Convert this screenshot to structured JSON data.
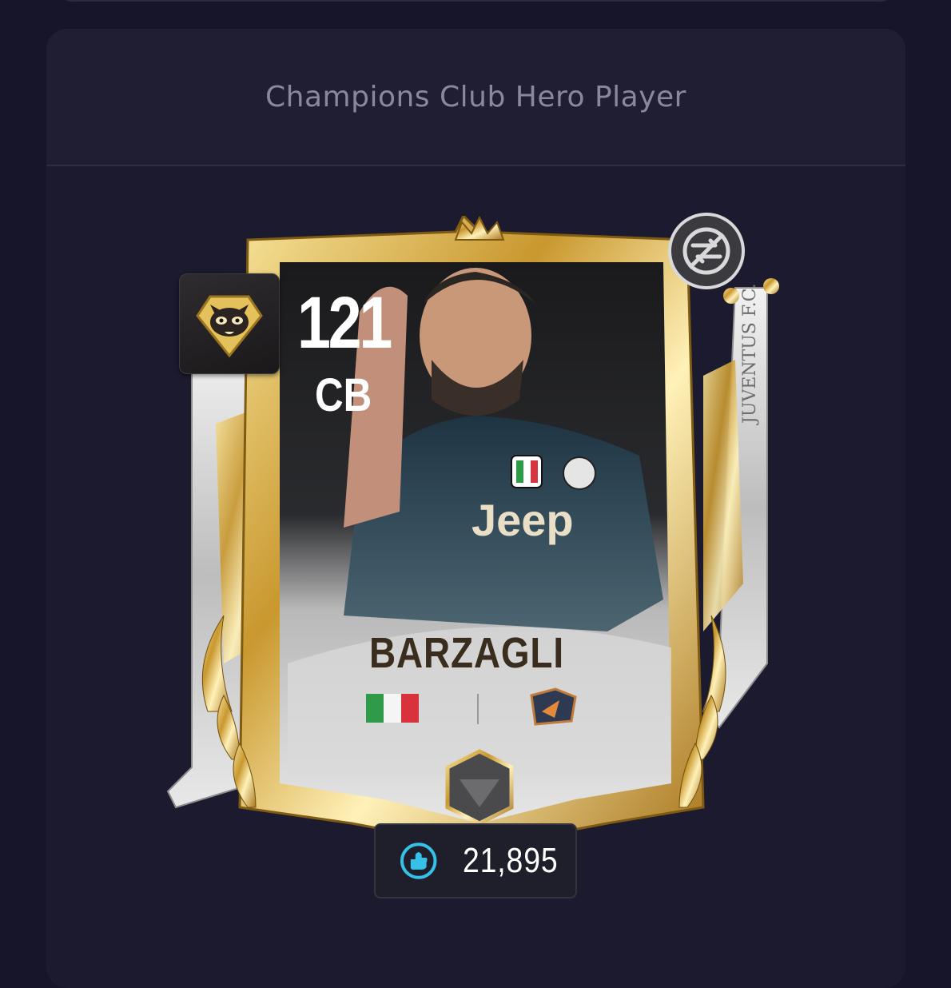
{
  "page": {
    "header_title": "Champions Club Hero Player"
  },
  "card": {
    "rating": "121",
    "position": "CB",
    "name": "BARZAGLI",
    "nation_flag": "italy-flag-icon",
    "club_badge": "club-badge-icon",
    "jersey_sponsor": "Jeep",
    "banner_text": "JUVENTUS F.C.",
    "frame_color": "#d4af37",
    "rank_icon": "raccoon-badge-icon",
    "untradeable_icon": "no-trade-icon"
  },
  "price": {
    "coin_icon": "fc-points-icon",
    "value": "21,895",
    "accent": "#35c1e8"
  }
}
